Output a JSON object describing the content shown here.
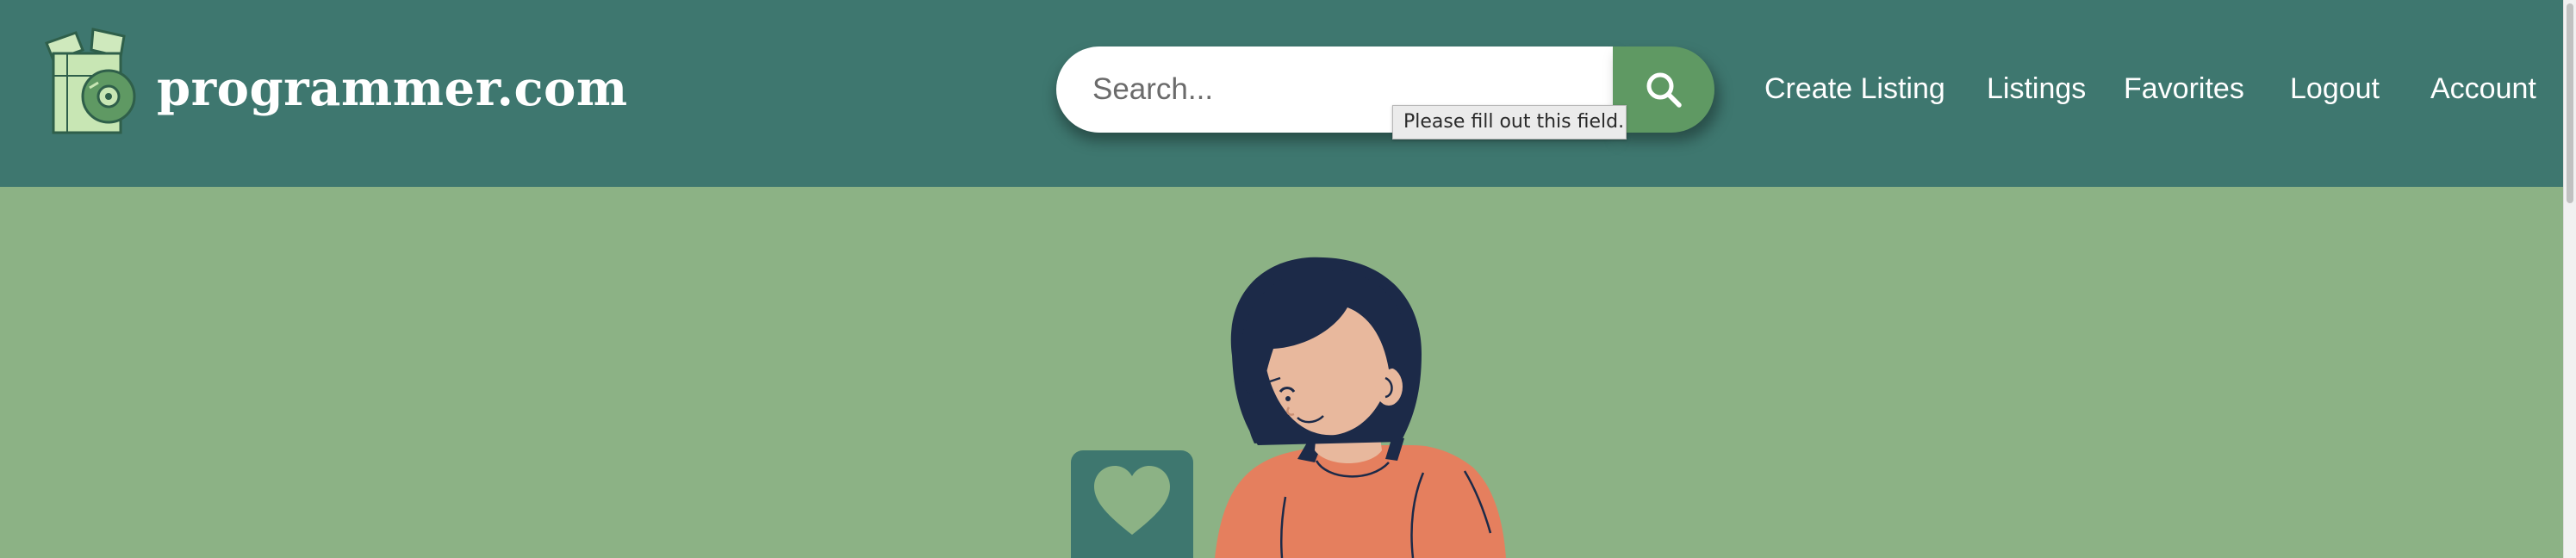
{
  "header": {
    "logo_text": "programmer.com",
    "logo_icon": "software-box-disc-icon"
  },
  "search": {
    "placeholder": "Search...",
    "value": "",
    "button_icon": "search-icon",
    "validation_tooltip": "Please fill out this field."
  },
  "nav": {
    "create_listing": "Create Listing",
    "listings": "Listings",
    "favorites": "Favorites",
    "logout": "Logout",
    "account": "Account"
  },
  "hero": {
    "illustration": "woman-with-heart-icon",
    "heart_icon": "heart-icon"
  },
  "colors": {
    "header_bg": "#3e776f",
    "page_bg": "#8cb285",
    "search_button": "#5f9963",
    "logo_light_green": "#c8e6b4"
  }
}
